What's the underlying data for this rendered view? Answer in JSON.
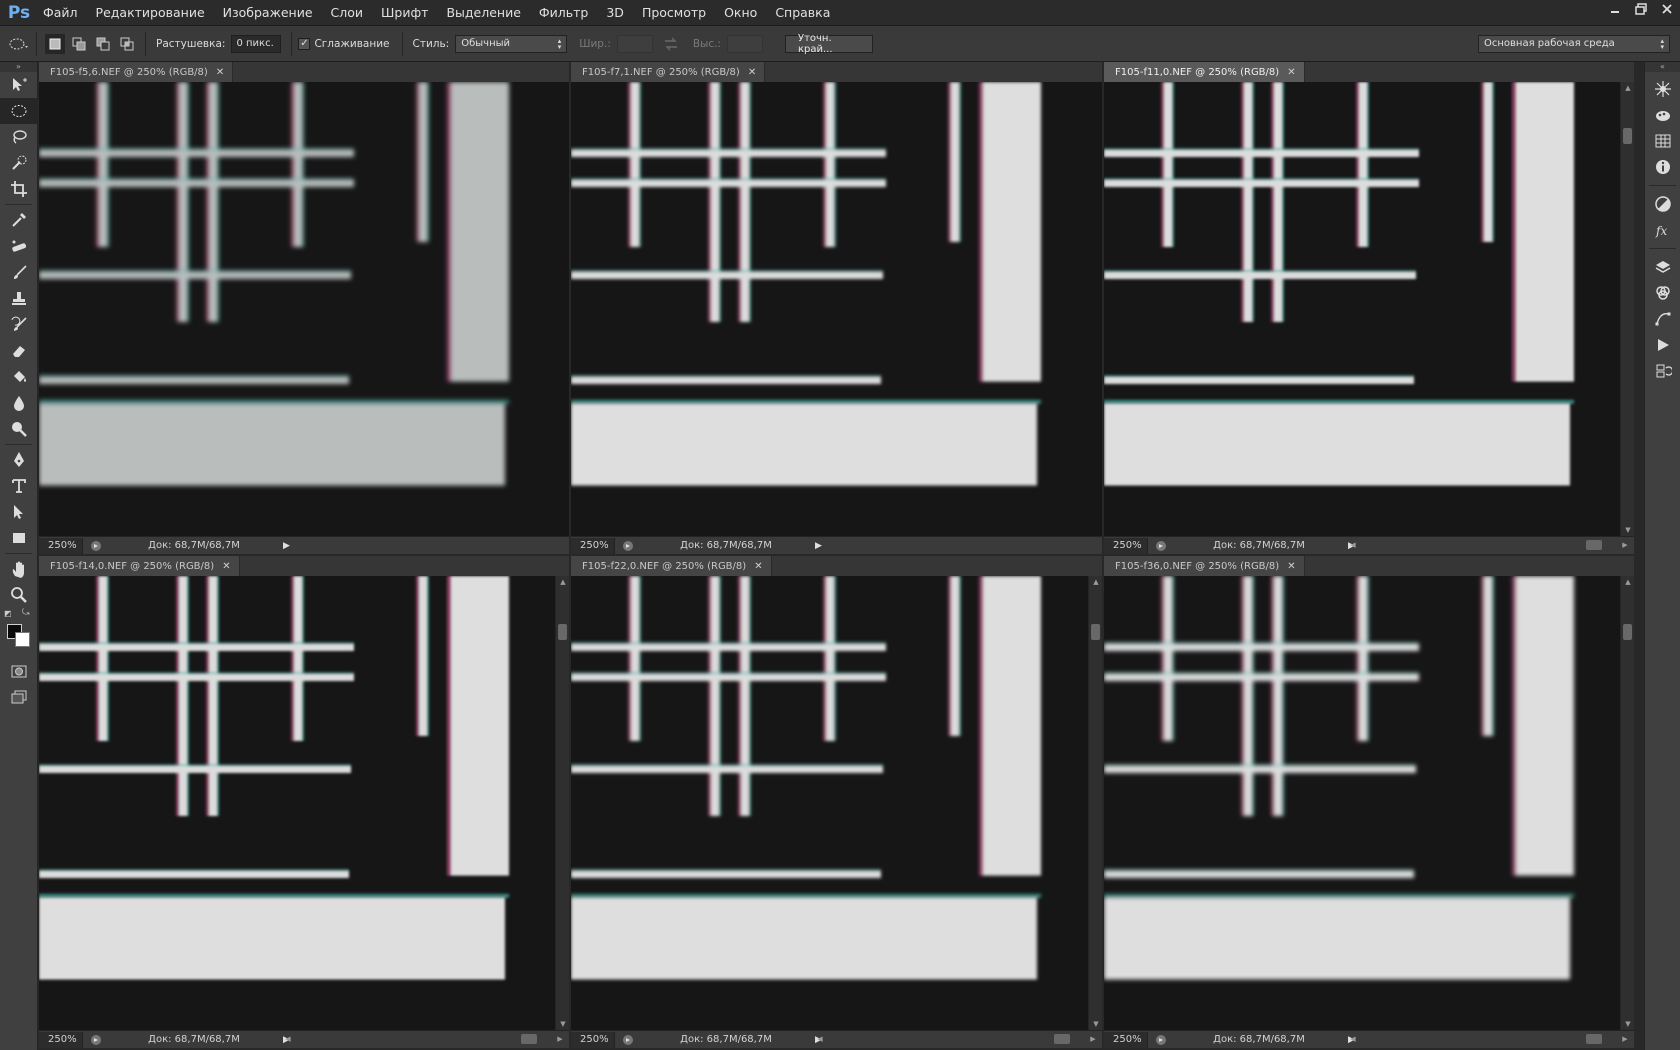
{
  "app": {
    "logo": "Ps",
    "menu": [
      "Файл",
      "Редактирование",
      "Изображение",
      "Слои",
      "Шрифт",
      "Выделение",
      "Фильтр",
      "3D",
      "Просмотр",
      "Окно",
      "Справка"
    ]
  },
  "options_bar": {
    "feather_label": "Растушевка:",
    "feather_value": "0 пикс.",
    "antialias_label": "Сглаживание",
    "antialias_checked": true,
    "style_label": "Стиль:",
    "style_value": "Обычный",
    "width_label": "Шир.:",
    "height_label": "Выс.:",
    "refine_edge_label": "Уточн. край...",
    "workspace_value": "Основная рабочая среда"
  },
  "documents": [
    {
      "title": "F105-f5,6.NEF @ 250% (RGB/8)",
      "zoom": "250%",
      "doc_info": "Док: 68,7M/68,7M",
      "active": false
    },
    {
      "title": "F105-f7,1.NEF @ 250% (RGB/8)",
      "zoom": "250%",
      "doc_info": "Док: 68,7M/68,7M",
      "active": false
    },
    {
      "title": "F105-f11,0.NEF @ 250% (RGB/8)",
      "zoom": "250%",
      "doc_info": "Док: 68,7M/68,7M",
      "active": true
    },
    {
      "title": "F105-f14,0.NEF @ 250% (RGB/8)",
      "zoom": "250%",
      "doc_info": "Док: 68,7M/68,7M",
      "active": false
    },
    {
      "title": "F105-f22,0.NEF @ 250% (RGB/8)",
      "zoom": "250%",
      "doc_info": "Док: 68,7M/68,7M",
      "active": false
    },
    {
      "title": "F105-f36,0.NEF @ 250% (RGB/8)",
      "zoom": "250%",
      "doc_info": "Док: 68,7M/68,7M",
      "active": false
    }
  ],
  "colors": {
    "foreground": "#000000",
    "background": "#ffffff",
    "ui_dark": "#282828",
    "ui_panel": "#404040"
  },
  "icons": {
    "tools": [
      "move-icon",
      "elliptical-marquee-icon",
      "lasso-icon",
      "quick-selection-icon",
      "crop-icon",
      "eyedropper-icon",
      "spot-healing-icon",
      "brush-icon",
      "clone-stamp-icon",
      "history-brush-icon",
      "eraser-icon",
      "paint-bucket-icon",
      "blur-icon",
      "dodge-icon",
      "pen-icon",
      "type-icon",
      "path-selection-icon",
      "rectangle-shape-icon",
      "hand-icon",
      "zoom-icon"
    ],
    "dock": [
      "navigator-icon",
      "color-icon",
      "swatches-icon",
      "info-icon",
      "adjustments-icon",
      "styles-icon",
      "layers-icon",
      "channels-icon",
      "paths-icon",
      "actions-icon",
      "history-icon"
    ]
  }
}
